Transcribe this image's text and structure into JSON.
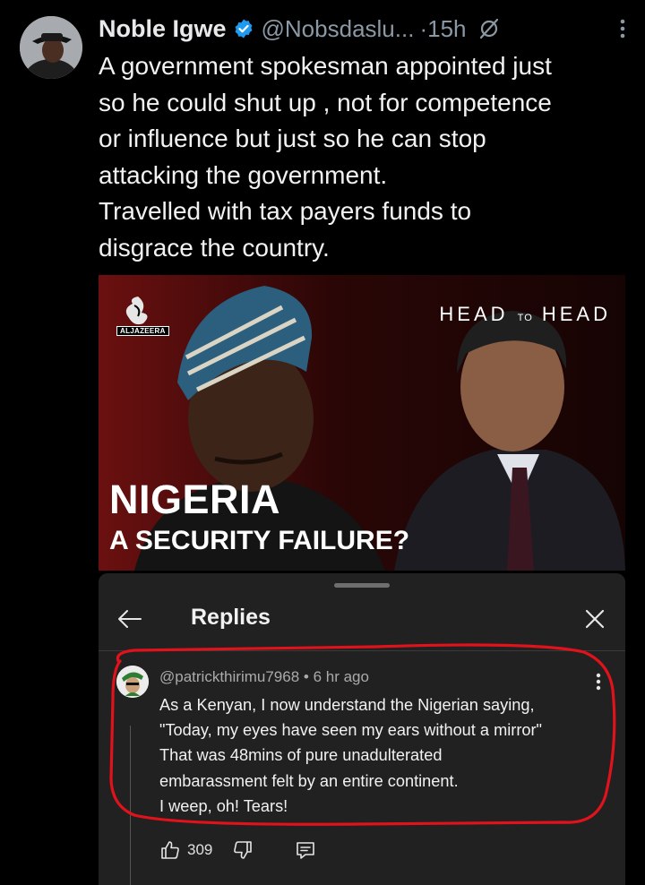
{
  "tweet": {
    "display_name": "Noble Igwe",
    "handle": "@Nobsdaslu...",
    "separator": "·",
    "time": "15h",
    "text": "A government spokesman appointed just\nso he could shut up , not for competence\nor influence but just so he can stop\nattacking the government.\nTravelled with tax payers funds to\ndisgrace the country."
  },
  "media": {
    "brand": "ALJAZEERA",
    "show_title": "HEAD TO HEAD",
    "headline_line1": "NIGERIA",
    "headline_line2": "A SECURITY FAILURE?"
  },
  "replies_panel": {
    "title": "Replies",
    "reply": {
      "author": "@patrickthirimu7968",
      "dot": "•",
      "time": "6 hr ago",
      "text": "As a Kenyan, I now understand the Nigerian saying,\n\"Today, my eyes have seen my ears without a mirror\"\nThat was 48mins of pure unadulterated\nembarassment felt by an entire continent.\nI weep, oh! Tears!",
      "like_count": "309"
    }
  },
  "icons": {
    "verified": "verified-badge-icon",
    "grok": "grok-icon",
    "more": "more-vertical-icon",
    "back": "arrow-left-icon",
    "close": "close-icon",
    "like": "thumbs-up-icon",
    "dislike": "thumbs-down-icon",
    "comment": "comment-icon"
  },
  "colors": {
    "background": "#000000",
    "sheet": "#212121",
    "verified_blue": "#1d9bf0",
    "secondary_text": "#8b98a5",
    "highlight_red": "#e0121b"
  }
}
